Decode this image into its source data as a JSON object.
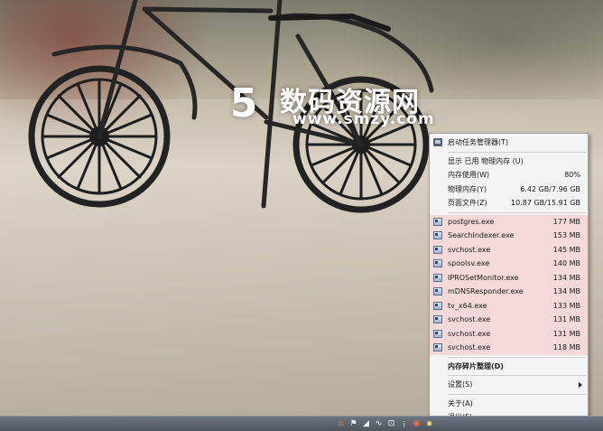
{
  "watermark": {
    "cn_text": "数码资源网",
    "url_text": "www.smzy.com"
  },
  "menu": {
    "task_manager": "启动任务管理器(T)",
    "display_label": "显示 已用 物理内存 (U)",
    "stats": [
      {
        "label": "内存使用(W)",
        "value": "80%"
      },
      {
        "label": "物理内存(Y)",
        "value": "6.42 GB/7.96 GB"
      },
      {
        "label": "页面文件(Z)",
        "value": "10.87 GB/15.91 GB"
      }
    ],
    "processes": [
      {
        "name": "postgres.exe",
        "mem": "177 MB"
      },
      {
        "name": "SearchIndexer.exe",
        "mem": "153 MB"
      },
      {
        "name": "svchost.exe",
        "mem": "145 MB"
      },
      {
        "name": "spoolsv.exe",
        "mem": "140 MB"
      },
      {
        "name": "IPROSetMonitor.exe",
        "mem": "134 MB"
      },
      {
        "name": "mDNSResponder.exe",
        "mem": "134 MB"
      },
      {
        "name": "tv_x64.exe",
        "mem": "133 MB"
      },
      {
        "name": "svchost.exe",
        "mem": "131 MB"
      },
      {
        "name": "svchost.exe",
        "mem": "131 MB"
      },
      {
        "name": "svchost.exe",
        "mem": "118 MB"
      }
    ],
    "defrag": "内存碎片整理(D)",
    "settings": "设置(S)",
    "about": "关于(A)",
    "exit": "退出(E)"
  },
  "colors": {
    "process_highlight": "#f5d8d8",
    "menu_bg": "#f4f4f4",
    "taskbar": "#5a626b"
  },
  "icons": {
    "tray": [
      "flame-icon",
      "flag-icon",
      "signal-icon",
      "link-icon",
      "network-icon",
      "pin-icon",
      "record-icon",
      "app-icon"
    ]
  }
}
